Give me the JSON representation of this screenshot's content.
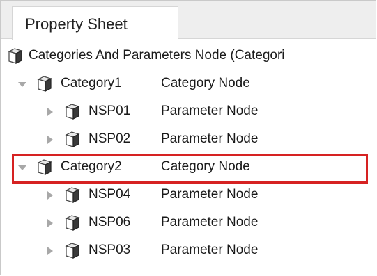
{
  "tab": {
    "label": "Property Sheet"
  },
  "tree": {
    "root": {
      "label": "Categories And Parameters Node  (Categori"
    },
    "rows": [
      {
        "name": "Category1",
        "type": "Category Node",
        "expanded": true
      },
      {
        "name": "NSP01",
        "type": "Parameter Node",
        "expanded": false
      },
      {
        "name": "NSP02",
        "type": "Parameter Node",
        "expanded": false
      },
      {
        "name": "Category2",
        "type": "Category Node",
        "expanded": true,
        "highlighted": true
      },
      {
        "name": "NSP04",
        "type": "Parameter Node",
        "expanded": false
      },
      {
        "name": "NSP06",
        "type": "Parameter Node",
        "expanded": false
      },
      {
        "name": "NSP03",
        "type": "Parameter Node",
        "expanded": false
      }
    ]
  },
  "colors": {
    "highlight": "#d62222",
    "tabstrip": "#eeeeee",
    "toggle": "#a8a8a8"
  },
  "icons": {
    "node": "cube-icon",
    "expanded": "triangle-down-icon",
    "collapsed": "triangle-right-icon"
  }
}
